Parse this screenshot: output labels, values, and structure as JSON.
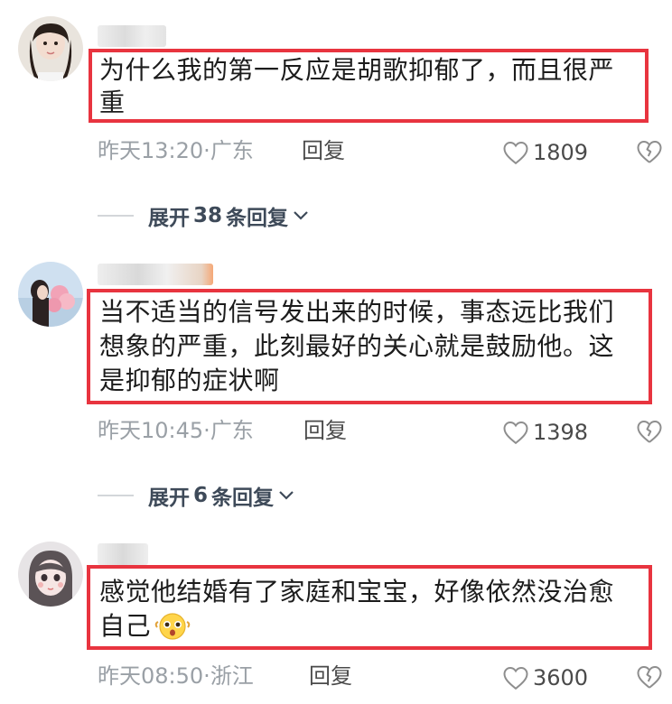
{
  "comments": [
    {
      "text": "为什么我的第一反应是胡歌抑郁了，而且很严重",
      "line1": "为什么我的第一反应是胡歌抑郁了，而且很严",
      "line2": "重",
      "date": "昨天",
      "time": "13:20",
      "location": "广东",
      "reply_label": "回复",
      "likes": "1809",
      "expand": {
        "prefix": "展开",
        "count": "38",
        "suffix": "条回复"
      }
    },
    {
      "line1": "当不适当的信号发出来的时候，事态远比我们",
      "line2": "想象的严重，此刻最好的关心就是鼓励他。这",
      "line3": "是抑郁的症状啊",
      "date": "昨天",
      "time": "10:45",
      "location": "广东",
      "reply_label": "回复",
      "likes": "1398",
      "expand": {
        "prefix": "展开",
        "count": "6",
        "suffix": "条回复"
      }
    },
    {
      "line1": "感觉他结婚有了家庭和宝宝，好像依然没治愈",
      "line2": "自己",
      "emoji": "emoji-face-icon",
      "date": "昨天",
      "time": "08:50",
      "location": "浙江",
      "reply_label": "回复",
      "likes": "3600"
    }
  ],
  "colors": {
    "highlight_border": "#e8343f",
    "meta_gray": "#9aa0a6",
    "expand_text": "#3e4a59"
  }
}
